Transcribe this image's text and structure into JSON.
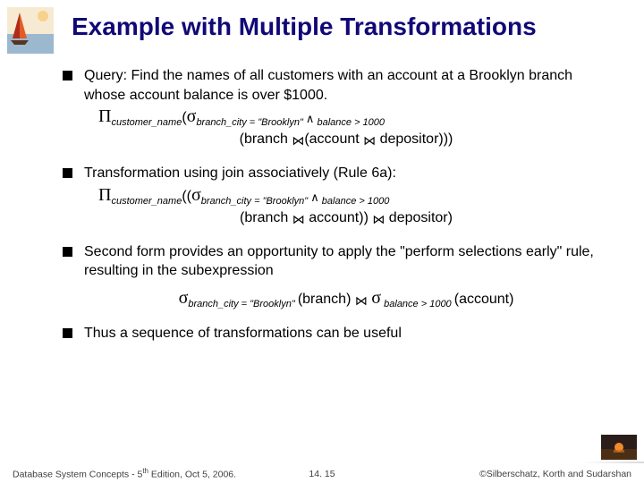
{
  "title": "Example with Multiple Transformations",
  "b1": {
    "text": "Query:  Find the names of all customers with an account at a Brooklyn branch whose account balance is over $1000.",
    "expr_sub1": "customer_name",
    "expr_sub2": "branch_city",
    "eq": " = \"Brooklyn\" ",
    "bal": " balance > 1000",
    "line2a": "(branch ",
    "line2b": "(account ",
    "line2c": " depositor",
    "line2d": ")))"
  },
  "b2": {
    "text": "Transformation using join associatively (Rule 6a):",
    "line2a": "(branch ",
    "line2b": "account",
    "line2c": ")) ",
    "line2d": " depositor",
    "line2e": ")"
  },
  "b3": {
    "text": "Second form provides an opportunity to apply the \"perform selections early\" rule, resulting in the subexpression",
    "eq": " = \"Brooklyn\" ",
    "branch": "(branch) ",
    "bal": " balance > 1000 ",
    "acct": "(account)"
  },
  "b4": {
    "text": "Thus a sequence of transformations can be useful"
  },
  "footer": {
    "left1": "Database System Concepts - 5",
    "left2": " Edition, Oct 5, 2006.",
    "mid": "14. 15",
    "right": "©Silberschatz, Korth and Sudarshan"
  }
}
